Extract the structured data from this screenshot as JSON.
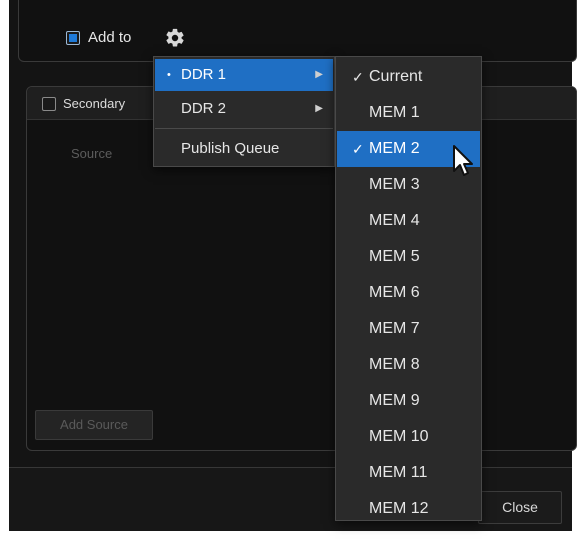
{
  "top_panel": {
    "add_to_label": "Add to",
    "gear_icon": "gear-icon"
  },
  "secondary_panel": {
    "checkbox_label": "Secondary",
    "source_label": "Source",
    "add_source_label": "Add Source"
  },
  "footer": {
    "close_label": "Close"
  },
  "context_menu": {
    "items": [
      {
        "label": "DDR 1",
        "active": true,
        "bullet": "•",
        "submenu": true
      },
      {
        "label": "DDR 2",
        "active": false,
        "bullet": "",
        "submenu": true
      },
      {
        "label": "Publish Queue",
        "active": false,
        "bullet": "",
        "submenu": false
      }
    ]
  },
  "submenu": {
    "items": [
      {
        "label": "Current",
        "checked": true,
        "active": false
      },
      {
        "label": "MEM 1",
        "checked": false,
        "active": false
      },
      {
        "label": "MEM 2",
        "checked": true,
        "active": true
      },
      {
        "label": "MEM 3",
        "checked": false,
        "active": false
      },
      {
        "label": "MEM 4",
        "checked": false,
        "active": false
      },
      {
        "label": "MEM 5",
        "checked": false,
        "active": false
      },
      {
        "label": "MEM 6",
        "checked": false,
        "active": false
      },
      {
        "label": "MEM 7",
        "checked": false,
        "active": false
      },
      {
        "label": "MEM 8",
        "checked": false,
        "active": false
      },
      {
        "label": "MEM 9",
        "checked": false,
        "active": false
      },
      {
        "label": "MEM 10",
        "checked": false,
        "active": false
      },
      {
        "label": "MEM 11",
        "checked": false,
        "active": false
      },
      {
        "label": "MEM 12",
        "checked": false,
        "active": false
      }
    ]
  },
  "colors": {
    "accent": "#1f6fc4",
    "background": "#141414",
    "menu_background": "#2a2a2a"
  }
}
